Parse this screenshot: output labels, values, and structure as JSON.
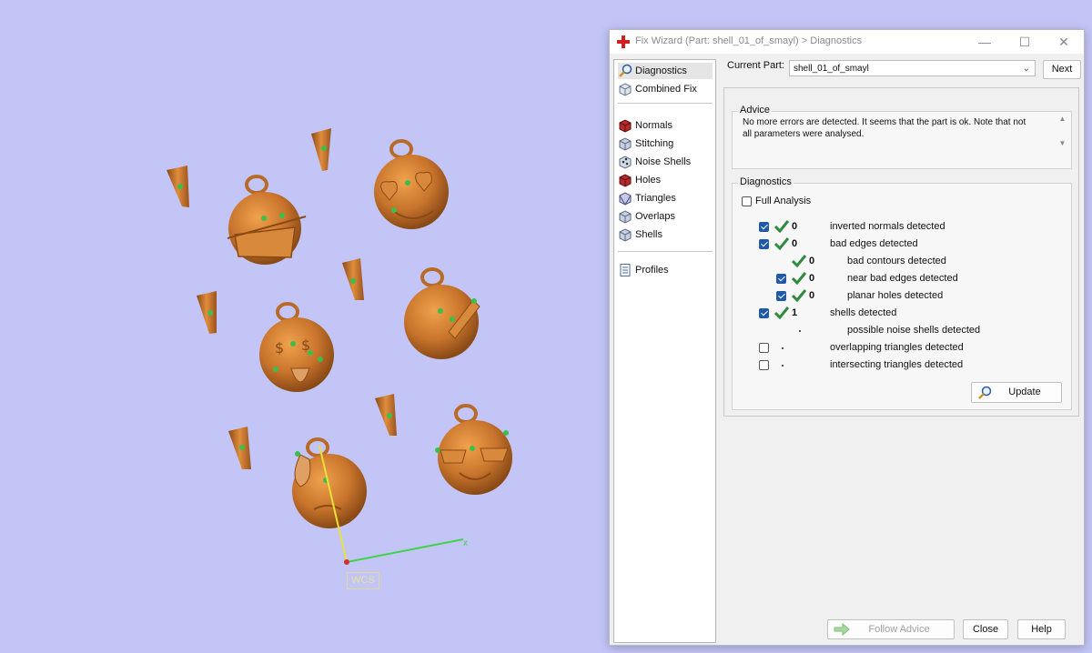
{
  "window": {
    "title": "Fix Wizard (Part: shell_01_of_smayl) > Diagnostics"
  },
  "nav": {
    "items": [
      {
        "label": "Diagnostics",
        "icon": "magnifier-icon"
      },
      {
        "label": "Combined Fix",
        "icon": "combined-fix-icon"
      },
      {
        "label": "Normals",
        "icon": "normals-cube-icon"
      },
      {
        "label": "Stitching",
        "icon": "stitching-cube-icon"
      },
      {
        "label": "Noise Shells",
        "icon": "noise-shells-icon"
      },
      {
        "label": "Holes",
        "icon": "holes-cube-icon"
      },
      {
        "label": "Triangles",
        "icon": "triangles-cube-icon"
      },
      {
        "label": "Overlaps",
        "icon": "overlaps-cube-icon"
      },
      {
        "label": "Shells",
        "icon": "shells-cube-icon"
      },
      {
        "label": "Profiles",
        "icon": "profiles-document-icon"
      }
    ]
  },
  "part": {
    "label": "Current Part:",
    "value": "shell_01_of_smayl",
    "next_label": "Next"
  },
  "advice": {
    "title": "Advice",
    "text": "No more errors are detected. It seems that the part is ok. Note that not all parameters were analysed."
  },
  "diagnostics": {
    "title": "Diagnostics",
    "full_analysis_label": "Full Analysis",
    "rows": [
      {
        "count": "0",
        "label": "inverted normals detected"
      },
      {
        "count": "0",
        "label": "bad edges detected"
      },
      {
        "count": "0",
        "label": "bad contours detected"
      },
      {
        "count": "0",
        "label": "near bad edges detected"
      },
      {
        "count": "0",
        "label": "planar holes detected"
      },
      {
        "count": "1",
        "label": "shells detected"
      },
      {
        "count": "",
        "label": "possible noise shells detected"
      },
      {
        "count": "",
        "label": "overlapping triangles detected"
      },
      {
        "count": "",
        "label": "intersecting triangles detected"
      }
    ],
    "update_label": "Update"
  },
  "footer": {
    "follow_advice_label": "Follow Advice",
    "close_label": "Close",
    "help_label": "Help"
  },
  "viewport": {
    "wcs_label": "WCS",
    "axis_x_label": "x"
  },
  "colors": {
    "viewport_bg": "#c3c5f7",
    "model_orange": "#c8742c",
    "check_green": "#2f8a3e",
    "checkbox_blue": "#1f5aa9"
  }
}
